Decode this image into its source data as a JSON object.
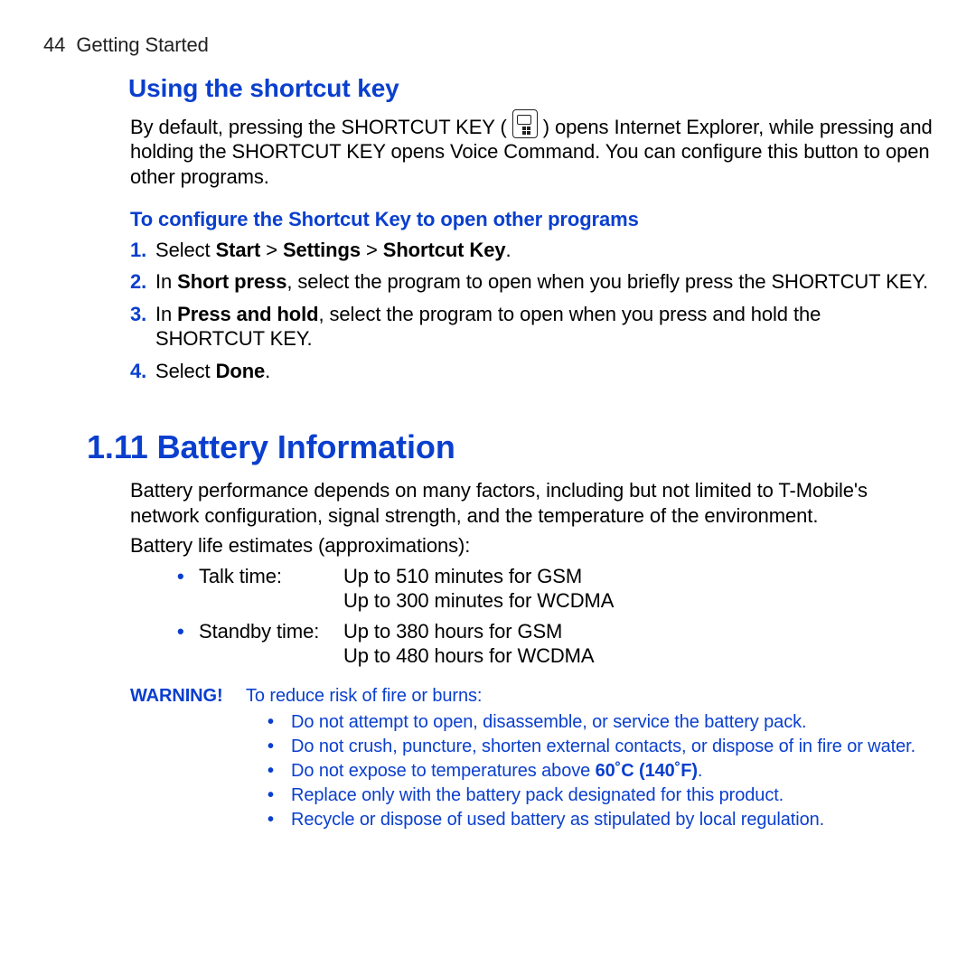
{
  "page": {
    "number": "44",
    "section": "Getting Started"
  },
  "shortcut": {
    "heading": "Using the shortcut key",
    "intro_pre": "By default, pressing the SHORTCUT KEY ( ",
    "intro_post": " ) opens Internet Explorer, while pressing and holding the SHORTCUT KEY opens Voice Command. You can configure this button to open other programs.",
    "sub": "To configure the Shortcut Key to open other programs",
    "steps": {
      "n1": "1.",
      "s1_pre": "Select ",
      "s1_b1": "Start",
      "s1_gt1": " > ",
      "s1_b2": "Settings",
      "s1_gt2": " > ",
      "s1_b3": "Shortcut Key",
      "s1_post": ".",
      "n2": "2.",
      "s2_pre": "In ",
      "s2_b": "Short press",
      "s2_post": ", select the program to open when you briefly press the SHORTCUT KEY.",
      "n3": "3.",
      "s3_pre": "In ",
      "s3_b": "Press and hold",
      "s3_post": ", select the program to open when you press and hold the SHORTCUT KEY.",
      "n4": "4.",
      "s4_pre": "Select ",
      "s4_b": "Done",
      "s4_post": "."
    }
  },
  "battery": {
    "heading": "1.11  Battery Information",
    "p1": "Battery performance depends on many factors, including but not limited to T-Mobile's network configuration, signal strength, and the temperature of the environment.",
    "p2": "Battery life estimates (approximations):",
    "talk_label": "Talk time:",
    "talk_v1": "Up to 510 minutes for GSM",
    "talk_v2": "Up to 300 minutes for WCDMA",
    "standby_label": "Standby time:",
    "standby_v1": "Up to 380 hours for GSM",
    "standby_v2": "Up to 480 hours for WCDMA"
  },
  "warning": {
    "label": "WARNING!",
    "intro": "To reduce risk of fire or burns:",
    "i1": "Do not attempt to open, disassemble, or service the battery pack.",
    "i2": "Do not crush, puncture, shorten external contacts, or dispose of in fire or water.",
    "i3_pre": "Do not expose to temperatures above ",
    "i3_b": "60˚C (140˚F)",
    "i3_post": ".",
    "i4": "Replace only with the battery pack designated for this product.",
    "i5": "Recycle or dispose of used battery as stipulated by local regulation."
  },
  "bullet": "•"
}
